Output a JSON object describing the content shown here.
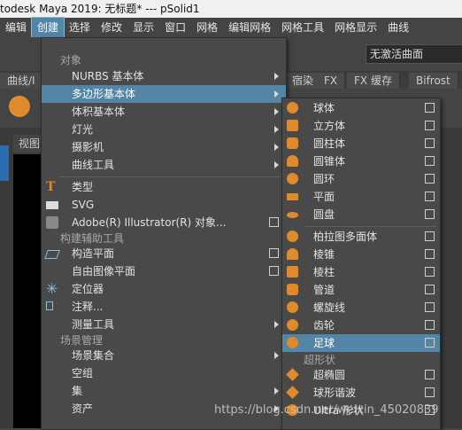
{
  "window": {
    "title": "todesk Maya 2019: 无标题*   ---   pSolid1"
  },
  "menubar": [
    "编辑",
    "创建",
    "选择",
    "修改",
    "显示",
    "窗口",
    "网格",
    "编辑网格",
    "网格工具",
    "网格显示",
    "曲线"
  ],
  "toolbar": {
    "active_field": "无激活曲面"
  },
  "shelf_tabs": [
    "曲线/I",
    "宿染",
    "FX",
    "FX 缓存",
    "Bifrost"
  ],
  "viewport": {
    "tab_label": "视图"
  },
  "create_menu": {
    "sections": {
      "objects": "对象",
      "construction_aids": "构建辅助工具",
      "scene_management": "场景管理"
    },
    "items": {
      "nurbs": "NURBS 基本体",
      "polygon": "多边形基本体",
      "volume": "体积基本体",
      "lights": "灯光",
      "cameras": "摄影机",
      "curve_tools": "曲线工具",
      "type": "类型",
      "svg": "SVG",
      "illustrator": "Adobe(R) Illustrator(R) 对象...",
      "construction_plane": "构造平面",
      "free_image_plane": "自由图像平面",
      "locator": "定位器",
      "annotation": "注释...",
      "measure_tools": "测量工具",
      "scene_assembly": "场景集合",
      "empty_group": "空组",
      "sets": "集",
      "assets": "资产"
    }
  },
  "polygon_submenu": {
    "items": [
      "球体",
      "立方体",
      "圆柱体",
      "圆锥体",
      "圆环",
      "平面",
      "圆盘",
      "柏拉图多面体",
      "棱锥",
      "棱柱",
      "管道",
      "螺旋线",
      "齿轮",
      "足球"
    ],
    "section_superformula": "超形状",
    "items2": [
      "超椭圆",
      "球形谐波",
      "Ultra 形状"
    ],
    "highlighted": "足球"
  },
  "watermark": "https://blog.csdn.net/weixin_45020839",
  "colors": {
    "highlight": "#5285a6",
    "menu_bg": "#494949",
    "icon_orange": "#e08a2e"
  }
}
